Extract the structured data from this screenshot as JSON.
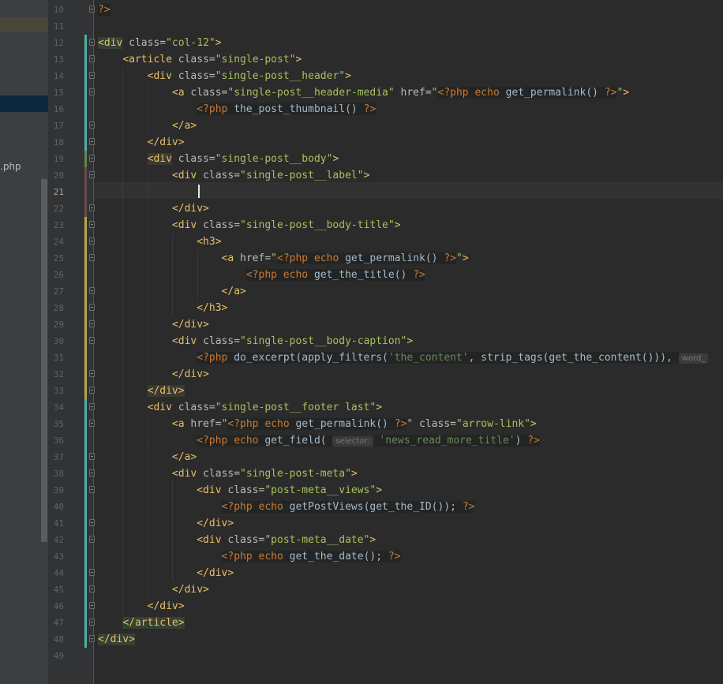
{
  "sidebar": {
    "file_fragment": ".php"
  },
  "editor": {
    "current_line": 21,
    "lines": [
      {
        "n": "10",
        "html": "<span class='p'>?&gt;</span>"
      },
      {
        "n": "11",
        "html": ""
      },
      {
        "n": "12",
        "html": "<span class='tb'>&lt;div</span> <span class='a'>class=</span><span class='s'>\"col-12\"</span><span class='t'>&gt;</span>"
      },
      {
        "n": "13",
        "html": "    <span class='t'>&lt;article</span> <span class='a'>class=</span><span class='s'>\"single-post\"</span><span class='t'>&gt;</span>"
      },
      {
        "n": "14",
        "html": "        <span class='t'>&lt;div</span> <span class='a'>class=</span><span class='s'>\"single-post__header\"</span><span class='t'>&gt;</span>"
      },
      {
        "n": "15",
        "html": "            <span class='t'>&lt;a</span> <span class='a'>class=</span><span class='s'>\"single-post__header-media\"</span> <span class='a'>href=</span><span class='s'>\"</span><span class='p'>&lt;?php echo</span><span class='ps'> get_permalink() </span><span class='p'>?&gt;</span><span class='s'>\"</span><span class='t'>&gt;</span>"
      },
      {
        "n": "16",
        "html": "                <span class='p'>&lt;?php</span><span class='ps'> the_post_thumbnail() </span><span class='p'>?&gt;</span>"
      },
      {
        "n": "17",
        "html": "            <span class='t'>&lt;/a&gt;</span>"
      },
      {
        "n": "18",
        "html": "        <span class='t'>&lt;/div&gt;</span>"
      },
      {
        "n": "19",
        "html": "        <span class='ty'>&lt;div</span> <span class='a'>class=</span><span class='s'>\"single-post__body\"</span><span class='t'>&gt;</span>"
      },
      {
        "n": "20",
        "html": "            <span class='t'>&lt;div</span> <span class='a'>class=</span><span class='s'>\"single-post__label\"</span><span class='t'>&gt;</span>"
      },
      {
        "n": "21",
        "html": ""
      },
      {
        "n": "22",
        "html": "            <span class='t'>&lt;/div&gt;</span>"
      },
      {
        "n": "23",
        "html": "            <span class='t'>&lt;div</span> <span class='a'>class=</span><span class='s'>\"single-post__body-title\"</span><span class='t'>&gt;</span>"
      },
      {
        "n": "24",
        "html": "                <span class='t'>&lt;h3&gt;</span>"
      },
      {
        "n": "25",
        "html": "                    <span class='t'>&lt;a</span> <span class='a'>href=</span><span class='s'>\"</span><span class='p'>&lt;?php echo</span><span class='ps'> get_permalink() </span><span class='p'>?&gt;</span><span class='s'>\"</span><span class='t'>&gt;</span>"
      },
      {
        "n": "26",
        "html": "                        <span class='p'>&lt;?php echo</span><span class='ps'> get_the_title() </span><span class='p'>?&gt;</span>"
      },
      {
        "n": "27",
        "html": "                    <span class='t'>&lt;/a&gt;</span>"
      },
      {
        "n": "28",
        "html": "                <span class='t'>&lt;/h3&gt;</span>"
      },
      {
        "n": "29",
        "html": "            <span class='t'>&lt;/div&gt;</span>"
      },
      {
        "n": "30",
        "html": "            <span class='t'>&lt;div</span> <span class='a'>class=</span><span class='s'>\"single-post__body-caption\"</span><span class='t'>&gt;</span>"
      },
      {
        "n": "31",
        "html": "                <span class='p'>&lt;?php</span><span class='ps'> do_excerpt(apply_filters(</span><span class='pw'>'the_content'</span><span class='ps'>, strip_tags(get_the_content())), </span><span class='hint'>word_</span>"
      },
      {
        "n": "32",
        "html": "            <span class='t'>&lt;/div&gt;</span>"
      },
      {
        "n": "33",
        "html": "        <span class='ty'>&lt;/div&gt;</span>"
      },
      {
        "n": "34",
        "html": "        <span class='t'>&lt;div</span> <span class='a'>class=</span><span class='s'>\"single-post__footer last\"</span><span class='t'>&gt;</span>"
      },
      {
        "n": "35",
        "html": "            <span class='t'>&lt;a</span> <span class='a'>href=</span><span class='s'>\"</span><span class='p'>&lt;?php echo</span><span class='ps'> get_permalink() </span><span class='p'>?&gt;</span><span class='s'>\"</span> <span class='a'>class=</span><span class='s'>\"arrow-link\"</span><span class='t'>&gt;</span>"
      },
      {
        "n": "36",
        "html": "                <span class='p'>&lt;?php echo</span><span class='ps'> get_field( </span><span class='hint'>selector:</span><span class='pw'> 'news_read_more_title'</span><span class='ps'>) </span><span class='p'>?&gt;</span>"
      },
      {
        "n": "37",
        "html": "            <span class='t'>&lt;/a&gt;</span>"
      },
      {
        "n": "38",
        "html": "            <span class='t'>&lt;div</span> <span class='a'>class=</span><span class='s'>\"single-post-meta\"</span><span class='t'>&gt;</span>"
      },
      {
        "n": "39",
        "html": "                <span class='t'>&lt;div</span> <span class='a'>class=</span><span class='s'>\"post-meta__views\"</span><span class='t'>&gt;</span>"
      },
      {
        "n": "40",
        "html": "                    <span class='p'>&lt;?php echo</span><span class='ps'> getPostViews(get_the_ID()); </span><span class='p'>?&gt;</span>"
      },
      {
        "n": "41",
        "html": "                <span class='t'>&lt;/div&gt;</span>"
      },
      {
        "n": "42",
        "html": "                <span class='t'>&lt;div</span> <span class='a'>class=</span><span class='s'>\"post-meta__date\"</span><span class='t'>&gt;</span>"
      },
      {
        "n": "43",
        "html": "                    <span class='p'>&lt;?php echo</span><span class='ps'> get_the_date(); </span><span class='p'>?&gt;</span>"
      },
      {
        "n": "44",
        "html": "                <span class='t'>&lt;/div&gt;</span>"
      },
      {
        "n": "45",
        "html": "            <span class='t'>&lt;/div&gt;</span>"
      },
      {
        "n": "46",
        "html": "        <span class='t'>&lt;/div&gt;</span>"
      },
      {
        "n": "47",
        "html": "    <span class='tb'>&lt;/article&gt;</span>"
      },
      {
        "n": "48",
        "html": "<span class='tb'>&lt;/div&gt;</span>"
      },
      {
        "n": "49",
        "html": ""
      }
    ]
  }
}
